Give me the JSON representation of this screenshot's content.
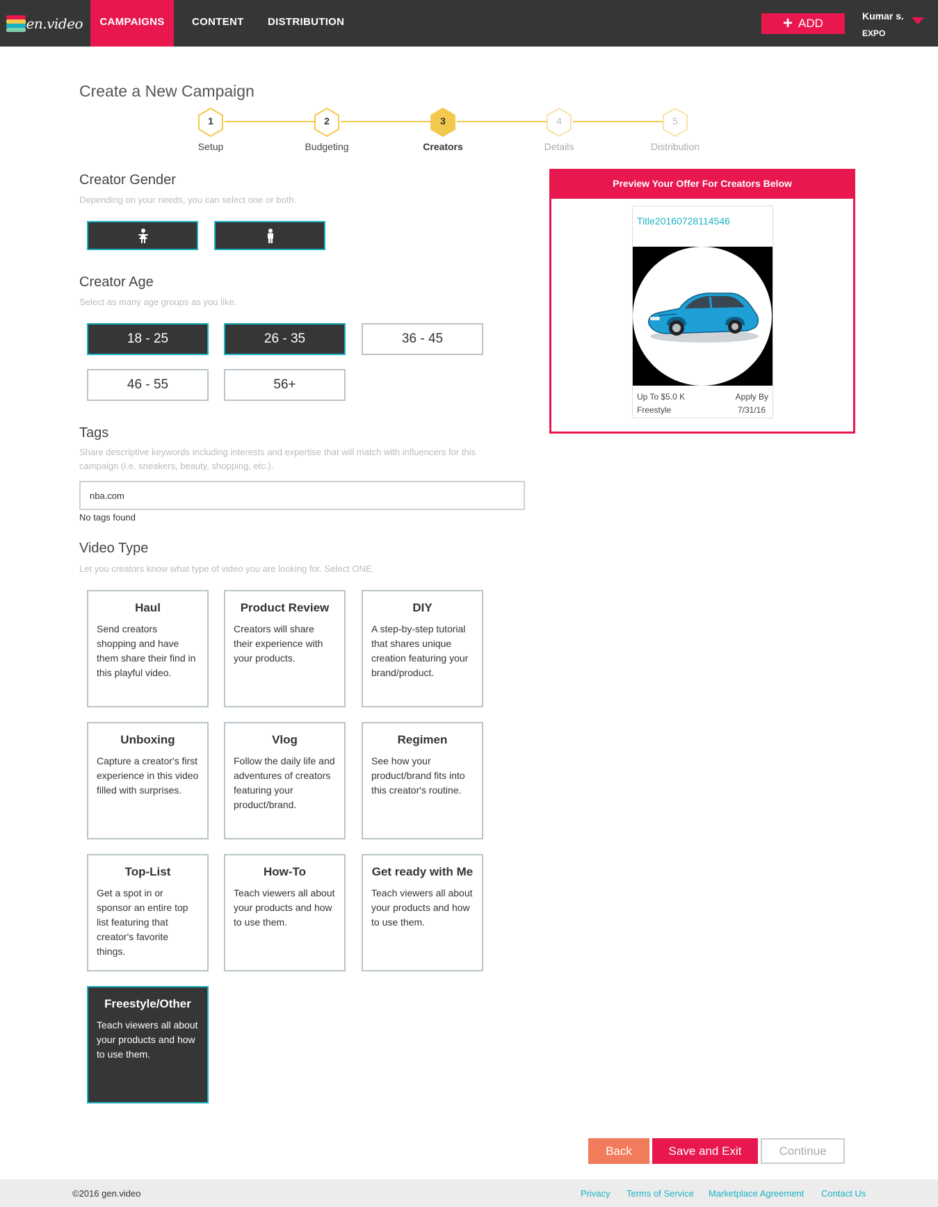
{
  "nav": {
    "logo_text": "gen.video",
    "tabs": [
      "CAMPAIGNS",
      "CONTENT",
      "DISTRIBUTION"
    ],
    "active_tab": "CAMPAIGNS",
    "add_label": "ADD",
    "user_name": "Kumar s.",
    "user_org": "EXPO",
    "accent_color": "#e8174e",
    "bg_color": "#363636"
  },
  "page": {
    "title": "Create a New Campaign"
  },
  "stepper": {
    "steps": [
      {
        "num": "1",
        "label": "Setup",
        "state": "completed"
      },
      {
        "num": "2",
        "label": "Budgeting",
        "state": "completed"
      },
      {
        "num": "3",
        "label": "Creators",
        "state": "current"
      },
      {
        "num": "4",
        "label": "Details",
        "state": "pending"
      },
      {
        "num": "5",
        "label": "Distribution",
        "state": "pending"
      }
    ],
    "active_color": "#f3c94d"
  },
  "gender": {
    "title": "Creator Gender",
    "help": "Depending on your needs, you can select one or both.",
    "options": [
      {
        "icon": "female-icon",
        "selected": true
      },
      {
        "icon": "male-icon",
        "selected": true
      }
    ]
  },
  "age": {
    "title": "Creator Age",
    "help": "Select as many age groups as you like.",
    "options": [
      {
        "label": "18 - 25",
        "selected": true
      },
      {
        "label": "26 - 35",
        "selected": true
      },
      {
        "label": "36 - 45",
        "selected": false
      },
      {
        "label": "46 - 55",
        "selected": false
      },
      {
        "label": "56+",
        "selected": false
      }
    ]
  },
  "tags": {
    "title": "Tags",
    "help_line1": "Share descriptive keywords including interests and expertise that will match with influencers for this",
    "help_line2": "campaign (i.e. sneakers, beauty, shopping, etc.).",
    "value": "nba.com",
    "note": "No tags found"
  },
  "video_type": {
    "title": "Video Type",
    "help": "Let you creators know what type of video you are looking for. Select ONE.",
    "cards": [
      {
        "title": "Haul",
        "desc": "Send creators shopping and have them share their find in this playful video.",
        "selected": false
      },
      {
        "title": "Product Review",
        "desc": "Creators will share their experience with your products.",
        "selected": false
      },
      {
        "title": "DIY",
        "desc": "A step-by-step tutorial that shares unique creation featuring your brand/product.",
        "selected": false
      },
      {
        "title": "Unboxing",
        "desc": "Capture a creator's first experience in this video filled with surprises.",
        "selected": false
      },
      {
        "title": "Vlog",
        "desc": "Follow the daily life and adventures of creators featuring your product/brand.",
        "selected": false
      },
      {
        "title": "Regimen",
        "desc": "See how your product/brand fits into this creator's routine.",
        "selected": false
      },
      {
        "title": "Top-List",
        "desc": "Get a spot in or sponsor an entire top list featuring that creator's favorite things.",
        "selected": false
      },
      {
        "title": "How-To",
        "desc": "Teach viewers all about your products and how to use them.",
        "selected": false
      },
      {
        "title": "Get ready with Me",
        "desc": "Teach viewers all about your products and how to use them.",
        "selected": false
      },
      {
        "title": "Freestyle/Other",
        "desc": "Teach viewers all about your products and how to use them.",
        "selected": true
      }
    ]
  },
  "preview": {
    "header": "Preview Your Offer For Creators Below",
    "offer_title": "Title20160728114546",
    "budget": "Up To $5.0 K",
    "apply_label": "Apply By",
    "type": "Freestyle",
    "apply_date": "7/31/16",
    "image_icon": "car-image"
  },
  "actions": {
    "back": "Back",
    "save": "Save and Exit",
    "continue": "Continue"
  },
  "footer": {
    "copyright": "©2016 gen.video",
    "links": [
      "Privacy",
      "Terms of Service",
      "Marketplace Agreement",
      "Contact Us"
    ]
  }
}
